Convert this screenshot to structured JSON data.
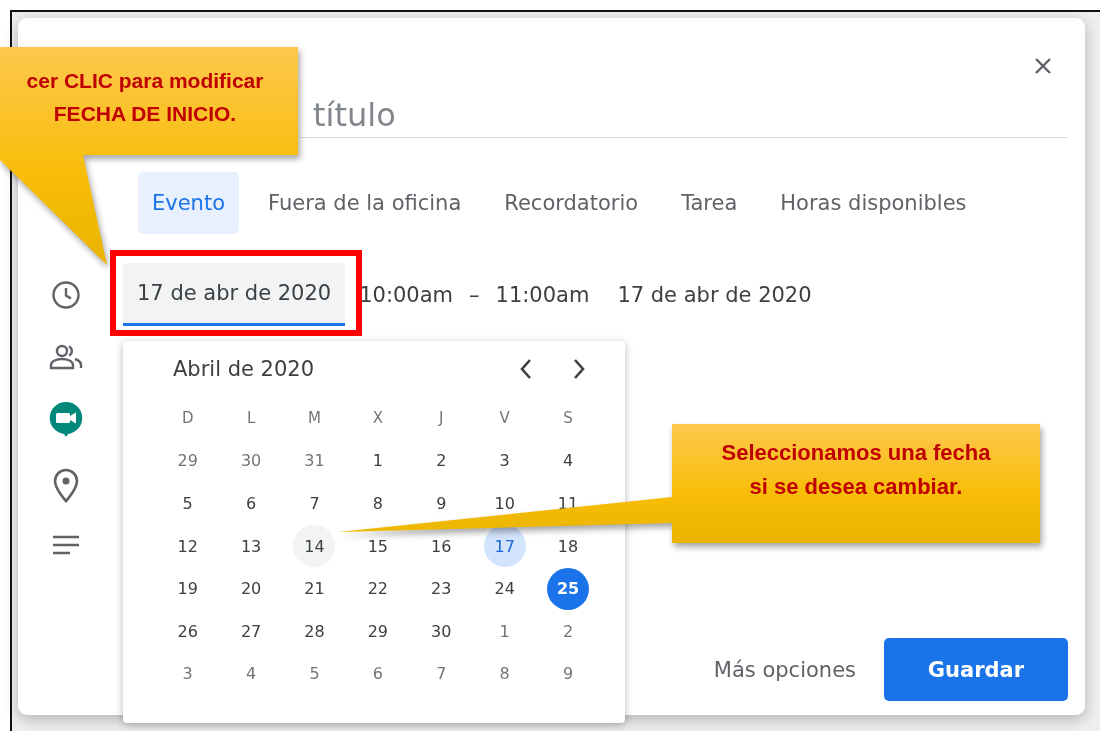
{
  "dialog": {
    "title_placeholder": "título",
    "tabs": [
      {
        "label": "Evento",
        "selected": true
      },
      {
        "label": "Fuera de la oficina",
        "selected": false
      },
      {
        "label": "Recordatorio",
        "selected": false
      },
      {
        "label": "Tarea",
        "selected": false
      },
      {
        "label": "Horas disponibles",
        "selected": false
      }
    ],
    "start_date": {
      "value": "17 de abr de 2020",
      "focused": true
    },
    "start_time": "10:00am",
    "separator": "–",
    "end_time": "11:00am",
    "end_date": "17 de abr de 2020",
    "more_options": "Más opciones",
    "save": "Guardar"
  },
  "date_picker": {
    "month": "Abril de 2020",
    "weekdays": [
      "D",
      "L",
      "M",
      "X",
      "J",
      "V",
      "S"
    ],
    "days": [
      {
        "label": "29",
        "other_month": true,
        "selected": false,
        "today": false,
        "hovered": false
      },
      {
        "label": "30",
        "other_month": true,
        "selected": false,
        "today": false,
        "hovered": false
      },
      {
        "label": "31",
        "other_month": true,
        "selected": false,
        "today": false,
        "hovered": false
      },
      {
        "label": "1",
        "other_month": false,
        "selected": false,
        "today": false,
        "hovered": false
      },
      {
        "label": "2",
        "other_month": false,
        "selected": false,
        "today": false,
        "hovered": false
      },
      {
        "label": "3",
        "other_month": false,
        "selected": false,
        "today": false,
        "hovered": false
      },
      {
        "label": "4",
        "other_month": false,
        "selected": false,
        "today": false,
        "hovered": false
      },
      {
        "label": "5",
        "other_month": false,
        "selected": false,
        "today": false,
        "hovered": false
      },
      {
        "label": "6",
        "other_month": false,
        "selected": false,
        "today": false,
        "hovered": false
      },
      {
        "label": "7",
        "other_month": false,
        "selected": false,
        "today": false,
        "hovered": false
      },
      {
        "label": "8",
        "other_month": false,
        "selected": false,
        "today": false,
        "hovered": false
      },
      {
        "label": "9",
        "other_month": false,
        "selected": false,
        "today": false,
        "hovered": false
      },
      {
        "label": "10",
        "other_month": false,
        "selected": false,
        "today": false,
        "hovered": false
      },
      {
        "label": "11",
        "other_month": false,
        "selected": false,
        "today": false,
        "hovered": false
      },
      {
        "label": "12",
        "other_month": false,
        "selected": false,
        "today": false,
        "hovered": false
      },
      {
        "label": "13",
        "other_month": false,
        "selected": false,
        "today": false,
        "hovered": false
      },
      {
        "label": "14",
        "other_month": false,
        "selected": false,
        "today": false,
        "hovered": true
      },
      {
        "label": "15",
        "other_month": false,
        "selected": false,
        "today": false,
        "hovered": false
      },
      {
        "label": "16",
        "other_month": false,
        "selected": false,
        "today": false,
        "hovered": false
      },
      {
        "label": "17",
        "other_month": false,
        "selected": true,
        "today": false,
        "hovered": false
      },
      {
        "label": "18",
        "other_month": false,
        "selected": false,
        "today": false,
        "hovered": false
      },
      {
        "label": "19",
        "other_month": false,
        "selected": false,
        "today": false,
        "hovered": false
      },
      {
        "label": "20",
        "other_month": false,
        "selected": false,
        "today": false,
        "hovered": false
      },
      {
        "label": "21",
        "other_month": false,
        "selected": false,
        "today": false,
        "hovered": false
      },
      {
        "label": "22",
        "other_month": false,
        "selected": false,
        "today": false,
        "hovered": false
      },
      {
        "label": "23",
        "other_month": false,
        "selected": false,
        "today": false,
        "hovered": false
      },
      {
        "label": "24",
        "other_month": false,
        "selected": false,
        "today": false,
        "hovered": false
      },
      {
        "label": "25",
        "other_month": false,
        "selected": false,
        "today": true,
        "hovered": false
      },
      {
        "label": "26",
        "other_month": false,
        "selected": false,
        "today": false,
        "hovered": false
      },
      {
        "label": "27",
        "other_month": false,
        "selected": false,
        "today": false,
        "hovered": false
      },
      {
        "label": "28",
        "other_month": false,
        "selected": false,
        "today": false,
        "hovered": false
      },
      {
        "label": "29",
        "other_month": false,
        "selected": false,
        "today": false,
        "hovered": false
      },
      {
        "label": "30",
        "other_month": false,
        "selected": false,
        "today": false,
        "hovered": false
      },
      {
        "label": "1",
        "other_month": true,
        "selected": false,
        "today": false,
        "hovered": false
      },
      {
        "label": "2",
        "other_month": true,
        "selected": false,
        "today": false,
        "hovered": false
      },
      {
        "label": "3",
        "other_month": true,
        "selected": false,
        "today": false,
        "hovered": false
      },
      {
        "label": "4",
        "other_month": true,
        "selected": false,
        "today": false,
        "hovered": false
      },
      {
        "label": "5",
        "other_month": true,
        "selected": false,
        "today": false,
        "hovered": false
      },
      {
        "label": "6",
        "other_month": true,
        "selected": false,
        "today": false,
        "hovered": false
      },
      {
        "label": "7",
        "other_month": true,
        "selected": false,
        "today": false,
        "hovered": false
      },
      {
        "label": "8",
        "other_month": true,
        "selected": false,
        "today": false,
        "hovered": false
      },
      {
        "label": "9",
        "other_month": true,
        "selected": false,
        "today": false,
        "hovered": false
      }
    ]
  },
  "callouts": [
    {
      "text": "cer CLIC para modificar\nFECHA DE INICIO."
    },
    {
      "text": "Seleccionamos una fecha\nsi se desea cambiar."
    }
  ]
}
